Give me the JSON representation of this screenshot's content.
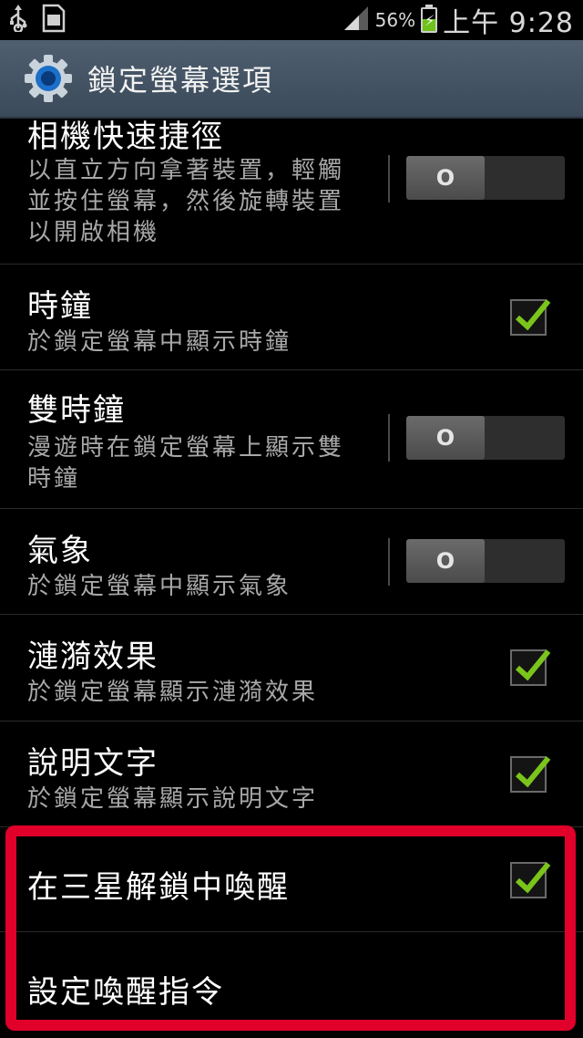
{
  "status_bar": {
    "battery_percent": "56%",
    "time": "上午 9:28",
    "icons": [
      "usb-icon",
      "sd-card-icon",
      "signal-icon",
      "battery-charging-icon"
    ]
  },
  "action_bar": {
    "title": "鎖定螢幕選項",
    "icon": "settings-gear-icon"
  },
  "settings": [
    {
      "title": "相機快速捷徑",
      "desc": "以直立方向拿著裝置，輕觸並按住螢幕，然後旋轉裝置以開啟相機",
      "control": "toggle",
      "state": "off",
      "toggle_label": "O"
    },
    {
      "title": "時鐘",
      "desc": "於鎖定螢幕中顯示時鐘",
      "control": "checkbox",
      "state": "checked"
    },
    {
      "title": "雙時鐘",
      "desc": "漫遊時在鎖定螢幕上顯示雙時鐘",
      "control": "toggle",
      "state": "off",
      "toggle_label": "O"
    },
    {
      "title": "氣象",
      "desc": "於鎖定螢幕中顯示氣象",
      "control": "toggle",
      "state": "off",
      "toggle_label": "O"
    },
    {
      "title": "漣漪效果",
      "desc": "於鎖定螢幕顯示漣漪效果",
      "control": "checkbox",
      "state": "checked"
    },
    {
      "title": "說明文字",
      "desc": "於鎖定螢幕顯示說明文字",
      "control": "checkbox",
      "state": "checked"
    },
    {
      "title": "在三星解鎖中喚醒",
      "control": "checkbox",
      "state": "checked"
    },
    {
      "title": "設定喚醒指令"
    }
  ],
  "colors": {
    "action_bar": "#44535f",
    "check": "#7ac41c",
    "highlight": "#e0002a"
  }
}
